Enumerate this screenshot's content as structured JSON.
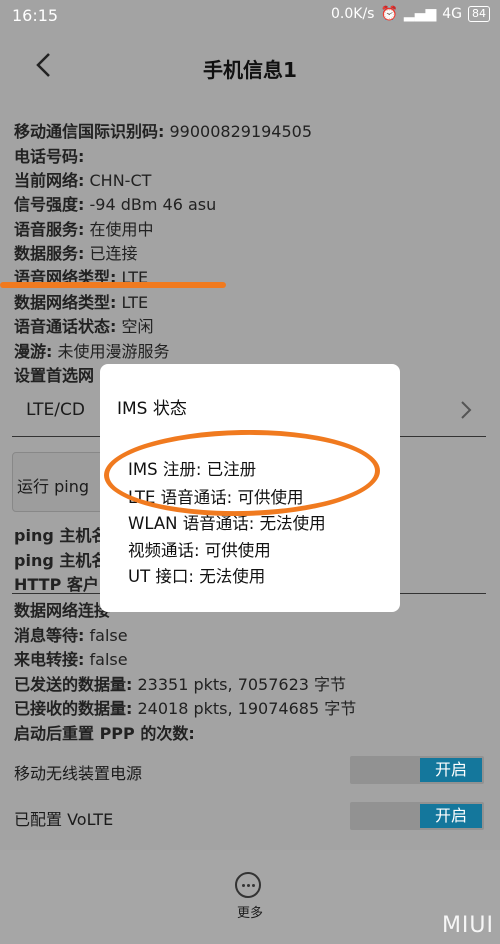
{
  "statusbar": {
    "time": "16:15",
    "speed": "0.0K/s",
    "network": "4G",
    "battery": "84"
  },
  "titlebar": {
    "title": "手机信息1"
  },
  "info": [
    {
      "key": "移动通信国际识别码:",
      "value": "99000829194505"
    },
    {
      "key": "电话号码:",
      "value": ""
    },
    {
      "key": "当前网络:",
      "value": "CHN-CT"
    },
    {
      "key": "信号强度:",
      "value": "-94 dBm   46 asu"
    },
    {
      "key": "语音服务:",
      "value": "在使用中"
    },
    {
      "key": "数据服务:",
      "value": "已连接"
    },
    {
      "key": "语音网络类型:",
      "value": "LTE"
    },
    {
      "key": "数据网络类型:",
      "value": "LTE"
    },
    {
      "key": "语音通话状态:",
      "value": "空闲"
    },
    {
      "key": "漫游:",
      "value": "未使用漫游服务"
    },
    {
      "key": "设置首选网",
      "value": ""
    }
  ],
  "dropdown": {
    "value": "LTE/CD"
  },
  "ping_button": {
    "label": "运行 ping"
  },
  "info2": [
    {
      "key": "ping 主机名",
      "value": ""
    },
    {
      "key": "ping 主机名",
      "value": ""
    },
    {
      "key": "HTTP 客户",
      "value": ""
    },
    {
      "key": "数据网络连接",
      "value": ""
    },
    {
      "key": "消息等待:",
      "value": "false"
    },
    {
      "key": "来电转接:",
      "value": "false"
    },
    {
      "key": "已发送的数据量:",
      "value": "23351 pkts, 7057623 字节"
    },
    {
      "key": "已接收的数据量:",
      "value": "24018 pkts, 19074685 字节"
    },
    {
      "key": "启动后重置 PPP 的次数:",
      "value": ""
    }
  ],
  "switches": [
    {
      "label": "移动无线装置电源",
      "state": "开启"
    },
    {
      "label": "已配置 VoLTE",
      "state": "开启"
    }
  ],
  "bottombar": {
    "more_label": "更多",
    "watermark": "MIUI"
  },
  "dialog": {
    "title": "IMS 状态",
    "items": [
      "IMS 注册: 已注册",
      "LTE 语音通话: 可供使用",
      "WLAN 语音通话: 无法使用",
      "视频通话: 可供使用",
      "UT 接口: 无法使用"
    ]
  },
  "colors": {
    "annotation": "#f07a1f",
    "toggle_on": "#14779c",
    "dim_background": "#a3a3a3"
  }
}
